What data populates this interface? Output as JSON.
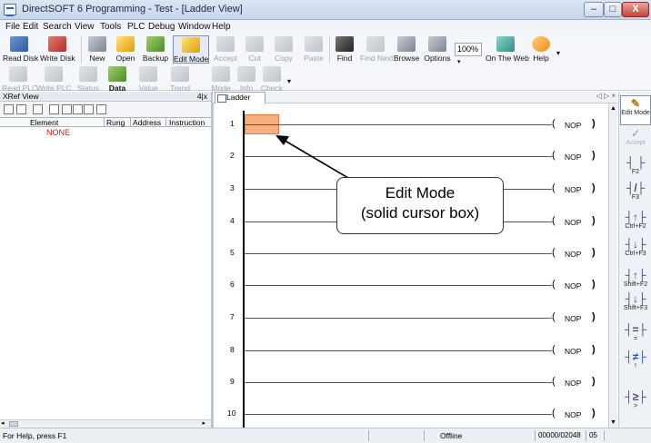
{
  "window": {
    "title": "DirectSOFT 6 Programming - Test - [Ladder View]",
    "min_symbol": "–",
    "max_symbol": "□",
    "close_symbol": "X"
  },
  "menu": [
    "File",
    "Edit",
    "Search",
    "View",
    "Tools",
    "PLC",
    "Debug",
    "Window",
    "Help"
  ],
  "toolbar1": {
    "buttons": [
      "Read Disk",
      "Write Disk",
      "New",
      "Open",
      "Backup",
      "Edit Mode",
      "Accept",
      "Cut",
      "Copy",
      "Paste",
      "Find",
      "Find Next",
      "Browse",
      "Options",
      "On The Web",
      "Help"
    ],
    "zoom": "100%",
    "zoom_arrow": "▾",
    "more": "▾"
  },
  "toolbar2": {
    "buttons": [
      "Read PLC",
      "Write PLC",
      "Status",
      "Data",
      "Value",
      "Trend",
      "Mode",
      "Info",
      "Check"
    ],
    "more": "▾"
  },
  "xref": {
    "title": "XRef View",
    "pin": "4|x",
    "columns": [
      "Element",
      "Rung",
      "Address",
      "Instruction"
    ],
    "rows": [
      "NONE"
    ]
  },
  "ladder": {
    "tab": "Ladder View",
    "tab_controls": "◁ ▷ ×",
    "rungs": [
      {
        "num": "1",
        "coil_l": "(",
        "coil": "NOP",
        "coil_r": ")"
      },
      {
        "num": "2",
        "coil_l": "(",
        "coil": "NOP",
        "coil_r": ")"
      },
      {
        "num": "3",
        "coil_l": "(",
        "coil": "NOP",
        "coil_r": ")"
      },
      {
        "num": "4",
        "coil_l": "(",
        "coil": "NOP",
        "coil_r": ")"
      },
      {
        "num": "5",
        "coil_l": "(",
        "coil": "NOP",
        "coil_r": ")"
      },
      {
        "num": "6",
        "coil_l": "(",
        "coil": "NOP",
        "coil_r": ")"
      },
      {
        "num": "7",
        "coil_l": "(",
        "coil": "NOP",
        "coil_r": ")"
      },
      {
        "num": "8",
        "coil_l": "(",
        "coil": "NOP",
        "coil_r": ")"
      },
      {
        "num": "9",
        "coil_l": "(",
        "coil": "NOP",
        "coil_r": ")"
      },
      {
        "num": "10",
        "coil_l": "(",
        "coil": "NOP",
        "coil_r": ")"
      }
    ],
    "callout_line1": "Edit Mode",
    "callout_line2": "(solid cursor box)"
  },
  "palette": [
    {
      "sym": "✎",
      "key": "Edit Mode"
    },
    {
      "sym": "✓",
      "key": "Accept"
    },
    {
      "sym": "┤ ├",
      "key": "F2"
    },
    {
      "sym": "┤/├",
      "key": "F3"
    },
    {
      "sym": "┤↑├",
      "key": "Ctrl+F2"
    },
    {
      "sym": "┤↓├",
      "key": "Ctrl+F3"
    },
    {
      "sym": "┤↑├",
      "key": "Shift+F2"
    },
    {
      "sym": "┤↓├",
      "key": "Shift+F3"
    },
    {
      "sym": "┤=├",
      "key": "="
    },
    {
      "sym": "┤≠├",
      "key": "!"
    },
    {
      "sym": "┤≥├",
      "key": ">"
    }
  ],
  "status": {
    "help": "For Help, press F1",
    "mode": "Offline",
    "address": "00000/02048",
    "column": "05"
  },
  "colors": {
    "cursor_fill": "#f6ad82",
    "cursor_border": "#e07a3c",
    "none_text": "#c0201a"
  }
}
